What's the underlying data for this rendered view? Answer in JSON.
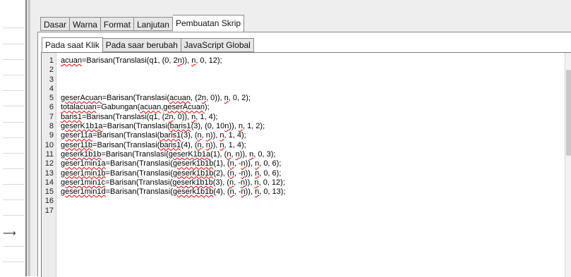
{
  "tabs": [
    {
      "label": "Dasar",
      "active": false
    },
    {
      "label": "Warna",
      "active": false
    },
    {
      "label": "Format",
      "active": false
    },
    {
      "label": "Lanjutan",
      "active": false
    },
    {
      "label": "Pembuatan Skrip",
      "active": true
    }
  ],
  "subtabs": [
    {
      "label": "Pada saat Klik",
      "active": true
    },
    {
      "label": "Pada saar berubah",
      "active": false
    },
    {
      "label": "JavaScript Global",
      "active": false
    }
  ],
  "left_arrow": "⟶",
  "code_lines": [
    {
      "n": "1",
      "text": "acuan=Barisan(Translasi(q1, (0, 2n)), n, 0, 12);"
    },
    {
      "n": "2",
      "text": ""
    },
    {
      "n": "3",
      "text": ""
    },
    {
      "n": "4",
      "text": ""
    },
    {
      "n": "5",
      "text": "geserAcuan=Barisan(Translasi(acuan, (2n, 0)), n, 0, 2);"
    },
    {
      "n": "6",
      "text": "totalacuan=Gabungan(acuan,geserAcuan);"
    },
    {
      "n": "7",
      "text": "baris1=Barisan(Translasi(q1, (2n, 0)), n, 1, 4);"
    },
    {
      "n": "8",
      "text": "geserK1b1a=Barisan(Translasi(baris1(3), (0, 10n)), n, 1, 2);"
    },
    {
      "n": "9",
      "text": "geser11a=Barisan(Translasi(baris1(3), (n, n)), n, 1, 4);"
    },
    {
      "n": "10",
      "text": "geser11b=Barisan(Translasi(baris1(4), (n, n)), n, 1, 4);"
    },
    {
      "n": "11",
      "text": "geserk1b1b=Barisan(Translasi(geserK1b1a(1), (n, n)), n, 0, 3);"
    },
    {
      "n": "12",
      "text": "geser1min1a=Barisan(Translasi(geserk1b1b(1), (n, -n)), n, 0, 6);"
    },
    {
      "n": "13",
      "text": "geser1min1b=Barisan(Translasi(geserk1b1b(2), (n, -n)), n, 0, 6);"
    },
    {
      "n": "14",
      "text": "geser1min1c=Barisan(Translasi(geserk1b1b(3), (n, -n)), n, 0, 12);"
    },
    {
      "n": "15",
      "text": "geser1min1d=Barisan(Translasi(geserk1b1b(4), (n, -n)), n, 0, 13);"
    },
    {
      "n": "16",
      "text": ""
    },
    {
      "n": "17",
      "text": ""
    }
  ],
  "colors": {
    "error_underline": "#d40000",
    "panel_bg": "#eeeeee",
    "gutter_bg": "#ececec"
  }
}
